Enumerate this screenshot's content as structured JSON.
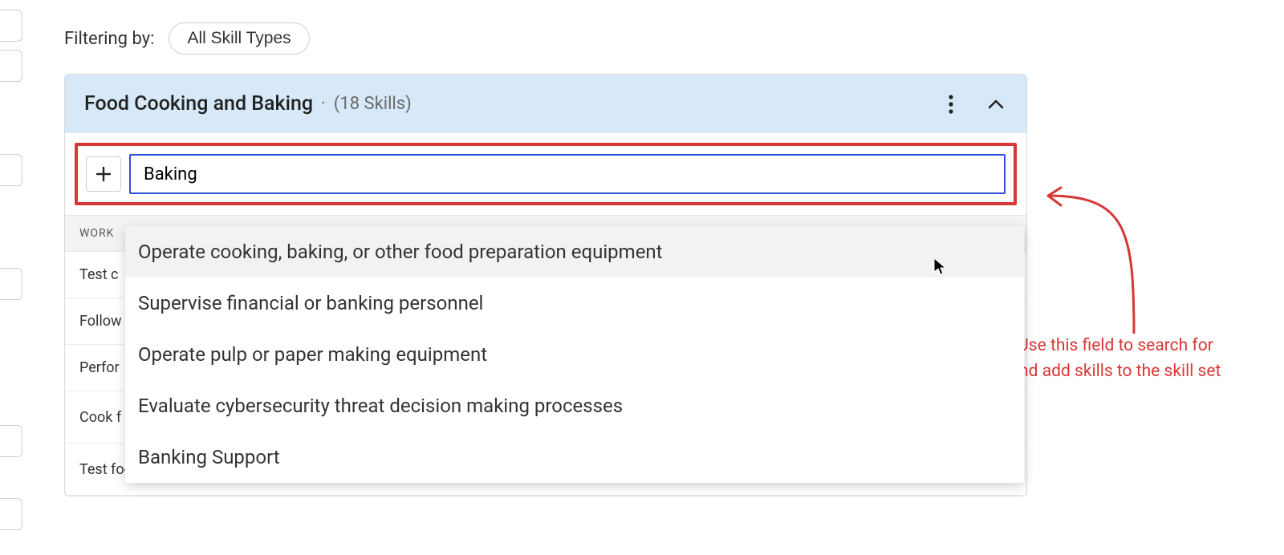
{
  "filter": {
    "label": "Filtering by:",
    "pill": "All Skill Types"
  },
  "card": {
    "title": "Food Cooking and Baking",
    "count_text": "(18 Skills)"
  },
  "search": {
    "value": "Baking"
  },
  "section_header": "WORK",
  "rows": [
    "Test c",
    "Follow",
    "Perfor",
    "Cook f",
    "Test food to determine that it is cooked"
  ],
  "dropdown": {
    "items": [
      "Operate cooking, baking, or other food preparation equipment",
      "Supervise financial or banking personnel",
      "Operate pulp or paper making equipment",
      "Evaluate cybersecurity threat decision making processes",
      "Banking Support"
    ]
  },
  "annotation": {
    "line1": "Use this field to search for",
    "line2": "and add skills to the skill set"
  },
  "colors": {
    "header_bg": "#d7e9f8",
    "focus_border": "#2b4fd6",
    "annotation": "#d93636"
  }
}
